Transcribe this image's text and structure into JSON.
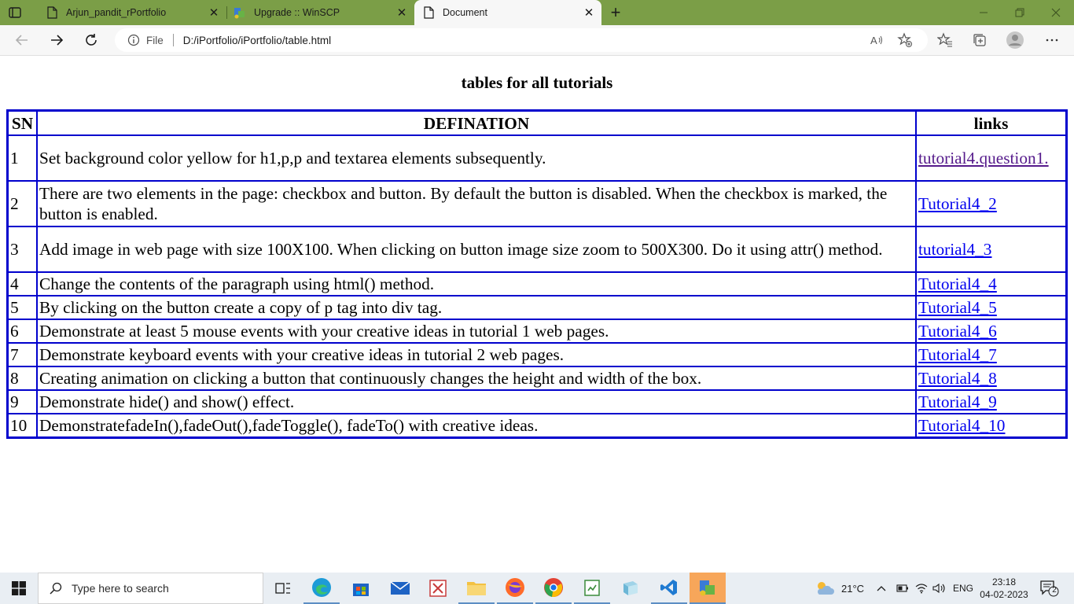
{
  "browser": {
    "tabs": [
      {
        "title": "Arjun_pandit_rPortfolio",
        "icon": "page-icon"
      },
      {
        "title": "Upgrade :: WinSCP",
        "icon": "winscp-icon"
      },
      {
        "title": "Document",
        "icon": "page-icon"
      }
    ],
    "address": {
      "scheme_label": "File",
      "url": "D:/iPortfolio/iPortfolio/table.html"
    },
    "theme_color": "#7b9e47"
  },
  "page": {
    "heading": "tables for all tutorials",
    "table": {
      "headers": [
        "SN",
        "DEFINATION",
        "links"
      ],
      "rows": [
        {
          "sn": "1",
          "definition": "Set background color yellow for h1,p,p and textarea elements subsequently.",
          "link": "tutorial4.question1."
        },
        {
          "sn": "2",
          "definition": "There are two elements in the page: checkbox and button. By default the button is disabled. When the checkbox is marked, the button is enabled.",
          "link": "Tutorial4_2"
        },
        {
          "sn": "3",
          "definition": "Add image in web page with size 100X100. When clicking on button image size zoom to 500X300. Do it using attr() method.",
          "link": "tutorial4_3"
        },
        {
          "sn": "4",
          "definition": "Change the contents of the paragraph using html() method.",
          "link": "Tutorial4_4"
        },
        {
          "sn": "5",
          "definition": "By clicking on the button create a copy of p tag into div tag.",
          "link": "Tutorial4_5"
        },
        {
          "sn": "6",
          "definition": "Demonstrate at least 5 mouse events with your creative ideas in tutorial 1 web pages.",
          "link": "Tutorial4_6"
        },
        {
          "sn": "7",
          "definition": "Demonstrate keyboard events with your creative ideas in tutorial 2 web pages.",
          "link": "Tutorial4_7"
        },
        {
          "sn": "8",
          "definition": "Creating animation on clicking a button that continuously changes the height and width of the box.",
          "link": "Tutorial4_8"
        },
        {
          "sn": "9",
          "definition": "Demonstrate hide() and show() effect.",
          "link": "Tutorial4_9"
        },
        {
          "sn": "10",
          "definition": "DemonstratefadeIn(),fadeOut(),fadeToggle(), fadeTo() with creative ideas.",
          "link": "Tutorial4_10"
        }
      ]
    },
    "border_color": "#0000cd",
    "link_color": "#0000ee",
    "visited_link_color": "#551a8b"
  },
  "taskbar": {
    "search_placeholder": "Type here to search",
    "weather": "21°C",
    "language": "ENG",
    "time": "23:18",
    "date": "04-02-2023",
    "notification_count": "2",
    "apps": [
      "task-view-icon",
      "edge-icon",
      "store-icon",
      "mail-icon",
      "app-icon",
      "file-explorer-icon",
      "firefox-icon",
      "chrome-icon",
      "notepad-icon",
      "app-icon",
      "vscode-icon",
      "winscp-icon"
    ]
  }
}
